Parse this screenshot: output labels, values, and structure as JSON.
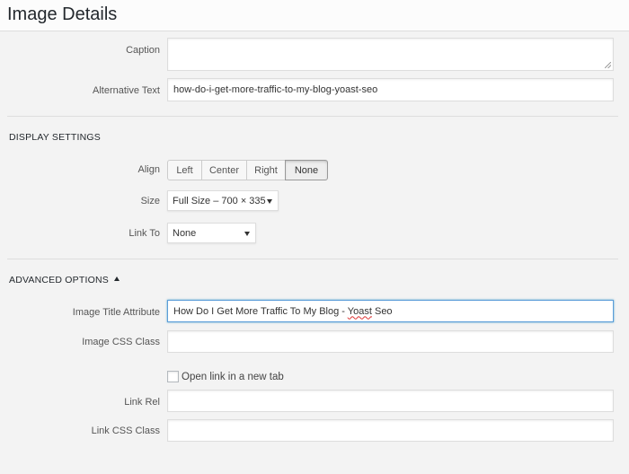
{
  "header": {
    "title": "Image Details"
  },
  "fields": {
    "caption": {
      "label": "Caption",
      "value": ""
    },
    "alt_text": {
      "label": "Alternative Text",
      "value": "how-do-i-get-more-traffic-to-my-blog-yoast-seo"
    }
  },
  "display_settings": {
    "title": "DISPLAY SETTINGS",
    "align": {
      "label": "Align",
      "options": [
        "Left",
        "Center",
        "Right",
        "None"
      ],
      "selected": "None"
    },
    "size": {
      "label": "Size",
      "value": "Full Size – 700 × 335"
    },
    "link_to": {
      "label": "Link To",
      "value": "None"
    }
  },
  "advanced_options": {
    "title": "ADVANCED OPTIONS",
    "image_title": {
      "label": "Image Title Attribute",
      "value_main": "How Do I Get More Traffic To My Blog - ",
      "value_misspelled": "Yoast",
      "value_tail": " Seo"
    },
    "image_css_class": {
      "label": "Image CSS Class",
      "value": ""
    },
    "new_tab": {
      "label": "Open link in a new tab",
      "checked": false
    },
    "link_rel": {
      "label": "Link Rel",
      "value": ""
    },
    "link_css_class": {
      "label": "Link CSS Class",
      "value": ""
    }
  },
  "colors": {
    "focus_border": "#5b9dd9",
    "background": "#f3f3f3",
    "header_bg": "#fcfcfc"
  }
}
